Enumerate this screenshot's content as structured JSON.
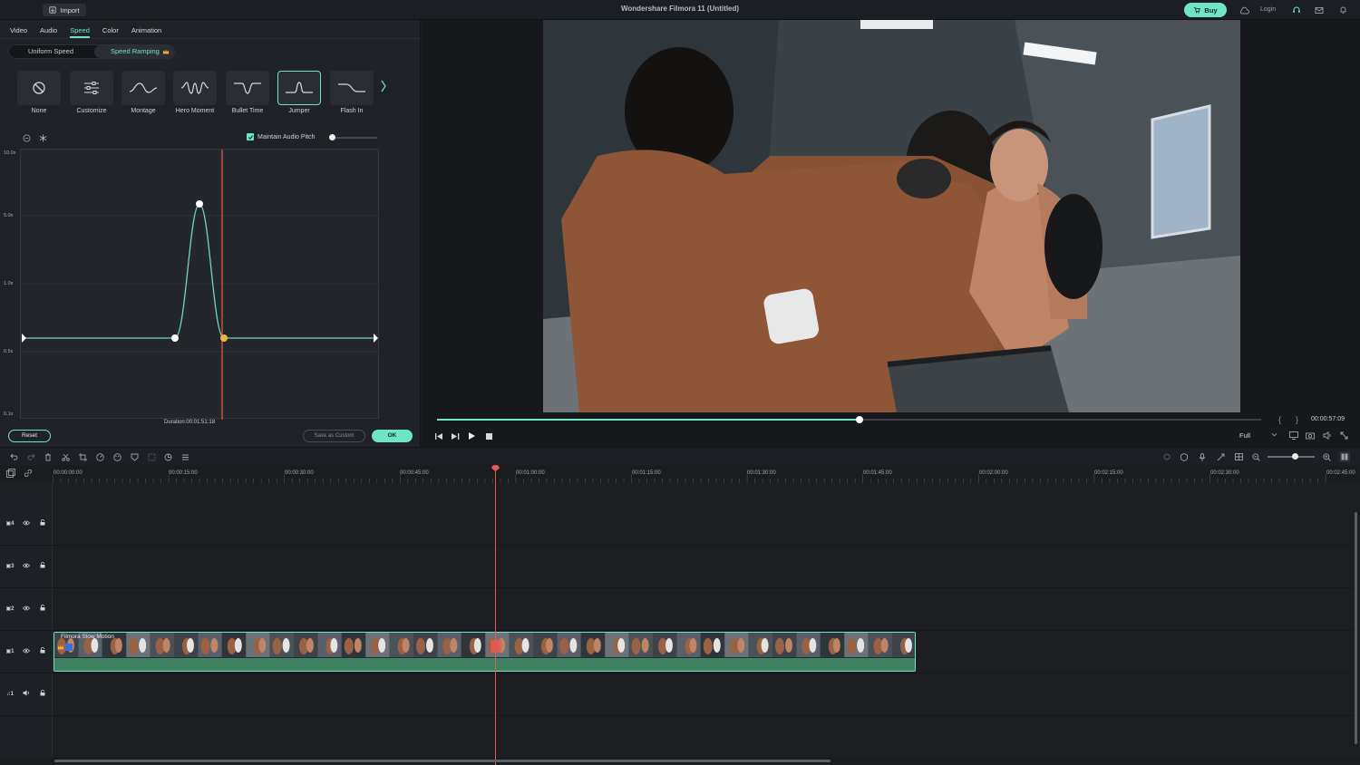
{
  "titlebar": {
    "import_label": "Import",
    "title": "Wondershare Filmora 11 (Untitled)",
    "buy_label": "Buy",
    "login_label": "Login"
  },
  "tabs": [
    {
      "label": "Video",
      "active": false
    },
    {
      "label": "Audio",
      "active": false
    },
    {
      "label": "Speed",
      "active": true
    },
    {
      "label": "Color",
      "active": false
    },
    {
      "label": "Animation",
      "active": false
    }
  ],
  "speed_mode": {
    "uniform_label": "Uniform Speed",
    "ramping_label": "Speed Ramping",
    "selected": "Speed Ramping"
  },
  "presets": [
    {
      "label": "None",
      "icon": "none-icon"
    },
    {
      "label": "Customize",
      "icon": "sliders-icon"
    },
    {
      "label": "Montage",
      "icon": "montage-curve-icon"
    },
    {
      "label": "Hero Moment",
      "icon": "hero-moment-curve-icon"
    },
    {
      "label": "Bullet Time",
      "icon": "bullet-time-curve-icon"
    },
    {
      "label": "Jumper",
      "icon": "jumper-curve-icon",
      "selected": true
    },
    {
      "label": "Flash In",
      "icon": "flash-in-curve-icon"
    }
  ],
  "graph": {
    "maintain_audio_pitch_label": "Maintain Audio Pitch",
    "maintain_audio_pitch_checked": true,
    "y_labels": [
      "10.0x",
      "5.0x",
      "1.0x",
      "0.5x",
      "0.1x"
    ],
    "duration_label": "Duration:00:01:51:18",
    "curve_color": "#6fd6c0",
    "playhead_color": "#e85a4f"
  },
  "actions": {
    "reset_label": "Reset",
    "save_custom_label": "Save as Custom",
    "ok_label": "OK"
  },
  "preview": {
    "time": "00:00:57:09",
    "quality": "Full",
    "progress_fraction": 0.513
  },
  "timeline": {
    "timecodes": [
      "00:00:00:00",
      "00:00:15:00",
      "00:00:30:00",
      "00:00:45:00",
      "00:01:00:00",
      "00:01:15:00",
      "00:01:30:00",
      "00:01:45:00",
      "00:02:00:00",
      "00:02:15:00",
      "00:02:30:00",
      "00:02:45:00"
    ],
    "tracks": [
      {
        "label": "4",
        "type": "video"
      },
      {
        "label": "3",
        "type": "video"
      },
      {
        "label": "2",
        "type": "video"
      },
      {
        "label": "1",
        "type": "video"
      },
      {
        "label": "1",
        "type": "audio"
      }
    ],
    "clip_title": "Filmora Slow Motion"
  },
  "colors": {
    "accent": "#6fe5c6",
    "playhead": "#e85a4f",
    "clip_audio": "#3f8160"
  }
}
